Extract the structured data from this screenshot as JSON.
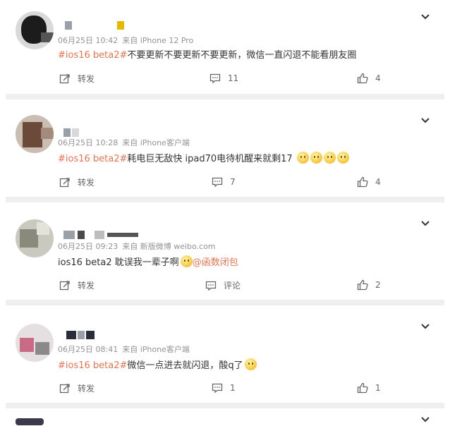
{
  "posts": [
    {
      "date": "06月25日 10:42",
      "source": "来自 iPhone 12 Pro",
      "tag": "#ios16 beta2#",
      "text": "不要更新不要更新不要更新，微信一直闪退不能看朋友圈",
      "emoji_count": 0,
      "mention": "",
      "repost": "转发",
      "comment": "11",
      "like": "4"
    },
    {
      "date": "06月25日 10:28",
      "source": "来自 iPhone客户端",
      "tag": "#ios16 beta2#",
      "text": "耗电巨无敌快 ipad70电待机醒来就剩17",
      "emoji_count": 4,
      "mention": "",
      "repost": "转发",
      "comment": "7",
      "like": "4"
    },
    {
      "date": "06月25日 09:23",
      "source": "来自 新版微博 weibo.com",
      "tag": "",
      "text": "ios16 beta2 耽误我一辈子啊",
      "emoji_count": 1,
      "mention": "@函数闭包",
      "repost": "转发",
      "comment": "评论",
      "like": "2"
    },
    {
      "date": "06月25日 08:41",
      "source": "来自 iPhone客户端",
      "tag": "#ios16 beta2#",
      "text": "微信一点进去就闪退，酸q了",
      "emoji_count": 1,
      "mention": "",
      "repost": "转发",
      "comment": "1",
      "like": "1"
    }
  ],
  "colors": {
    "accent": "#eb7350",
    "meta": "#939393",
    "separator": "#efefef"
  },
  "icons": [
    "repost-icon",
    "comment-icon",
    "like-icon",
    "chevron-down-icon",
    "emoji-icon"
  ]
}
